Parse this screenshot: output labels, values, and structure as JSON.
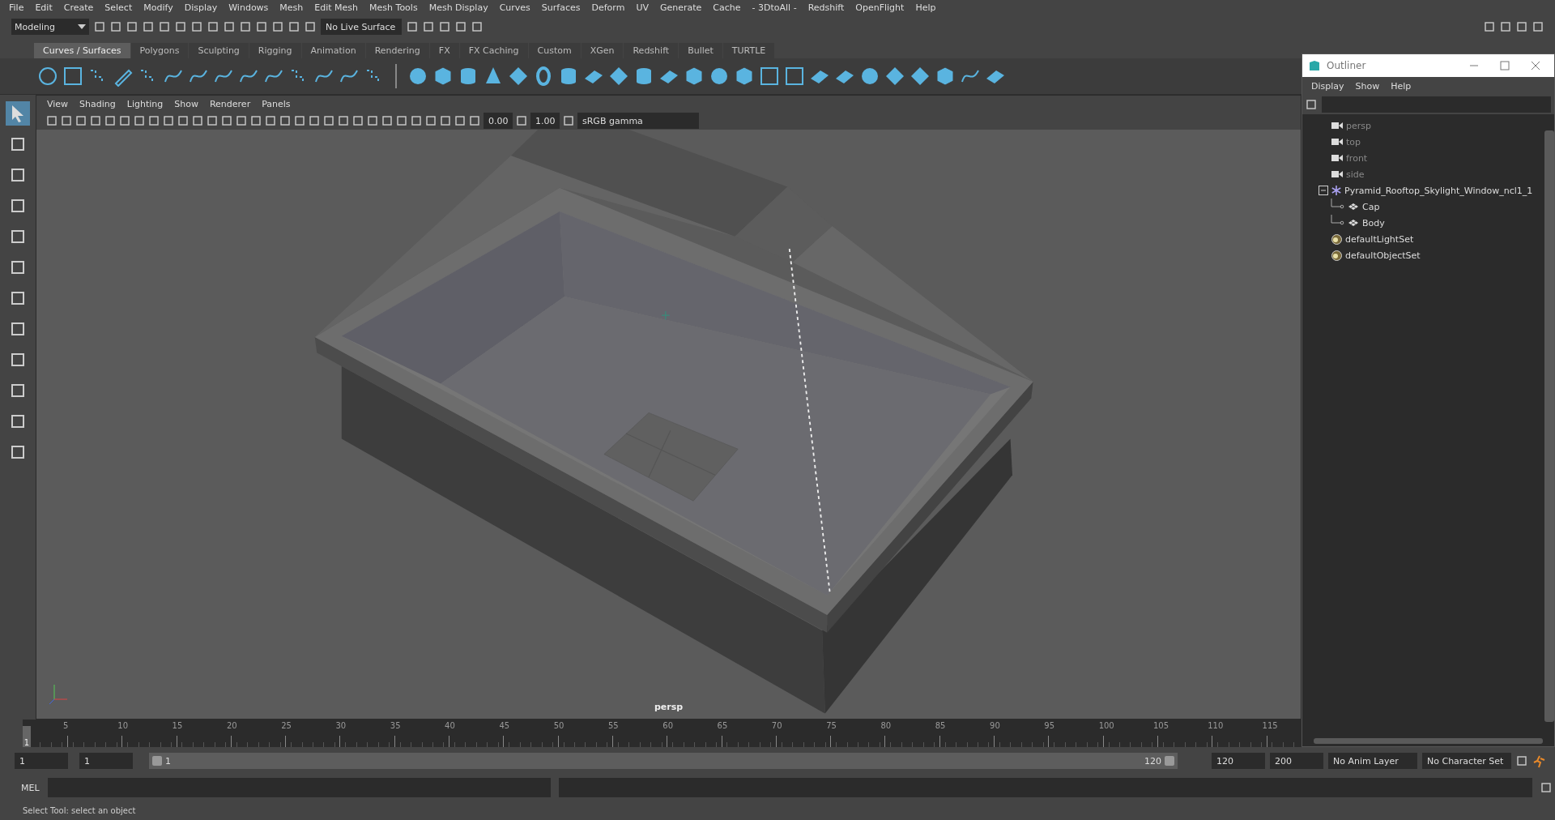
{
  "menu_bar": [
    "File",
    "Edit",
    "Create",
    "Select",
    "Modify",
    "Display",
    "Windows",
    "Mesh",
    "Edit Mesh",
    "Mesh Tools",
    "Mesh Display",
    "Curves",
    "Surfaces",
    "Deform",
    "UV",
    "Generate",
    "Cache",
    "- 3DtoAll -",
    "Redshift",
    "OpenFlight",
    "Help"
  ],
  "status_line": {
    "menu_set": "Modeling",
    "live_surface": "No Live Surface"
  },
  "shelf": {
    "tabs": [
      {
        "label": "Curves / Surfaces",
        "selected": true
      },
      {
        "label": "Polygons",
        "selected": false
      },
      {
        "label": "Sculpting",
        "selected": false
      },
      {
        "label": "Rigging",
        "selected": false
      },
      {
        "label": "Animation",
        "selected": false
      },
      {
        "label": "Rendering",
        "selected": false
      },
      {
        "label": "FX",
        "selected": false
      },
      {
        "label": "FX Caching",
        "selected": false
      },
      {
        "label": "Custom",
        "selected": false
      },
      {
        "label": "XGen",
        "selected": false
      },
      {
        "label": "Redshift",
        "selected": false
      },
      {
        "label": "Bullet",
        "selected": false
      },
      {
        "label": "TURTLE",
        "selected": false
      }
    ]
  },
  "viewport": {
    "menu": [
      "View",
      "Shading",
      "Lighting",
      "Show",
      "Renderer",
      "Panels"
    ],
    "exposure": "0.00",
    "gamma": "1.00",
    "color_space": "sRGB gamma",
    "camera_label": "persp"
  },
  "outliner": {
    "title": "Outliner",
    "menu": [
      "Display",
      "Show",
      "Help"
    ],
    "items": [
      {
        "kind": "camera",
        "label": "persp"
      },
      {
        "kind": "camera",
        "label": "top"
      },
      {
        "kind": "camera",
        "label": "front"
      },
      {
        "kind": "camera",
        "label": "side"
      },
      {
        "kind": "group",
        "label": "Pyramid_Rooftop_Skylight_Window_ncl1_1",
        "expanded": true,
        "children": [
          {
            "kind": "mesh",
            "label": "Cap"
          },
          {
            "kind": "mesh",
            "label": "Body"
          }
        ]
      },
      {
        "kind": "set",
        "label": "defaultLightSet"
      },
      {
        "kind": "set",
        "label": "defaultObjectSet"
      }
    ]
  },
  "timeline": {
    "current_frame": "1",
    "level": 0,
    "ticks": [
      "5",
      "10",
      "15",
      "20",
      "25",
      "30",
      "35",
      "40",
      "45",
      "50",
      "55",
      "60",
      "65",
      "70",
      "75",
      "80",
      "85",
      "90",
      "95",
      "100",
      "105",
      "110",
      "115"
    ]
  },
  "range": {
    "level": 1,
    "start": "1",
    "current": "1",
    "slider_start": "1",
    "slider_end": "120",
    "end": "120",
    "anim_end": "200",
    "anim_layer": "No Anim Layer",
    "character_set": "No Character Set"
  },
  "command_line": {
    "label": "MEL"
  },
  "help_line": "Select Tool: select an object"
}
